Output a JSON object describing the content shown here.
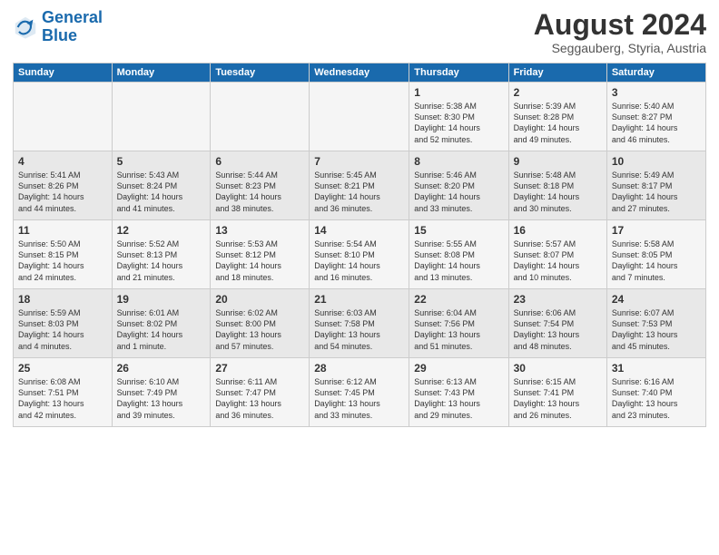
{
  "header": {
    "logo_line1": "General",
    "logo_line2": "Blue",
    "month_title": "August 2024",
    "location": "Seggauberg, Styria, Austria"
  },
  "days_of_week": [
    "Sunday",
    "Monday",
    "Tuesday",
    "Wednesday",
    "Thursday",
    "Friday",
    "Saturday"
  ],
  "weeks": [
    [
      {
        "num": "",
        "info": ""
      },
      {
        "num": "",
        "info": ""
      },
      {
        "num": "",
        "info": ""
      },
      {
        "num": "",
        "info": ""
      },
      {
        "num": "1",
        "info": "Sunrise: 5:38 AM\nSunset: 8:30 PM\nDaylight: 14 hours\nand 52 minutes."
      },
      {
        "num": "2",
        "info": "Sunrise: 5:39 AM\nSunset: 8:28 PM\nDaylight: 14 hours\nand 49 minutes."
      },
      {
        "num": "3",
        "info": "Sunrise: 5:40 AM\nSunset: 8:27 PM\nDaylight: 14 hours\nand 46 minutes."
      }
    ],
    [
      {
        "num": "4",
        "info": "Sunrise: 5:41 AM\nSunset: 8:26 PM\nDaylight: 14 hours\nand 44 minutes."
      },
      {
        "num": "5",
        "info": "Sunrise: 5:43 AM\nSunset: 8:24 PM\nDaylight: 14 hours\nand 41 minutes."
      },
      {
        "num": "6",
        "info": "Sunrise: 5:44 AM\nSunset: 8:23 PM\nDaylight: 14 hours\nand 38 minutes."
      },
      {
        "num": "7",
        "info": "Sunrise: 5:45 AM\nSunset: 8:21 PM\nDaylight: 14 hours\nand 36 minutes."
      },
      {
        "num": "8",
        "info": "Sunrise: 5:46 AM\nSunset: 8:20 PM\nDaylight: 14 hours\nand 33 minutes."
      },
      {
        "num": "9",
        "info": "Sunrise: 5:48 AM\nSunset: 8:18 PM\nDaylight: 14 hours\nand 30 minutes."
      },
      {
        "num": "10",
        "info": "Sunrise: 5:49 AM\nSunset: 8:17 PM\nDaylight: 14 hours\nand 27 minutes."
      }
    ],
    [
      {
        "num": "11",
        "info": "Sunrise: 5:50 AM\nSunset: 8:15 PM\nDaylight: 14 hours\nand 24 minutes."
      },
      {
        "num": "12",
        "info": "Sunrise: 5:52 AM\nSunset: 8:13 PM\nDaylight: 14 hours\nand 21 minutes."
      },
      {
        "num": "13",
        "info": "Sunrise: 5:53 AM\nSunset: 8:12 PM\nDaylight: 14 hours\nand 18 minutes."
      },
      {
        "num": "14",
        "info": "Sunrise: 5:54 AM\nSunset: 8:10 PM\nDaylight: 14 hours\nand 16 minutes."
      },
      {
        "num": "15",
        "info": "Sunrise: 5:55 AM\nSunset: 8:08 PM\nDaylight: 14 hours\nand 13 minutes."
      },
      {
        "num": "16",
        "info": "Sunrise: 5:57 AM\nSunset: 8:07 PM\nDaylight: 14 hours\nand 10 minutes."
      },
      {
        "num": "17",
        "info": "Sunrise: 5:58 AM\nSunset: 8:05 PM\nDaylight: 14 hours\nand 7 minutes."
      }
    ],
    [
      {
        "num": "18",
        "info": "Sunrise: 5:59 AM\nSunset: 8:03 PM\nDaylight: 14 hours\nand 4 minutes."
      },
      {
        "num": "19",
        "info": "Sunrise: 6:01 AM\nSunset: 8:02 PM\nDaylight: 14 hours\nand 1 minute."
      },
      {
        "num": "20",
        "info": "Sunrise: 6:02 AM\nSunset: 8:00 PM\nDaylight: 13 hours\nand 57 minutes."
      },
      {
        "num": "21",
        "info": "Sunrise: 6:03 AM\nSunset: 7:58 PM\nDaylight: 13 hours\nand 54 minutes."
      },
      {
        "num": "22",
        "info": "Sunrise: 6:04 AM\nSunset: 7:56 PM\nDaylight: 13 hours\nand 51 minutes."
      },
      {
        "num": "23",
        "info": "Sunrise: 6:06 AM\nSunset: 7:54 PM\nDaylight: 13 hours\nand 48 minutes."
      },
      {
        "num": "24",
        "info": "Sunrise: 6:07 AM\nSunset: 7:53 PM\nDaylight: 13 hours\nand 45 minutes."
      }
    ],
    [
      {
        "num": "25",
        "info": "Sunrise: 6:08 AM\nSunset: 7:51 PM\nDaylight: 13 hours\nand 42 minutes."
      },
      {
        "num": "26",
        "info": "Sunrise: 6:10 AM\nSunset: 7:49 PM\nDaylight: 13 hours\nand 39 minutes."
      },
      {
        "num": "27",
        "info": "Sunrise: 6:11 AM\nSunset: 7:47 PM\nDaylight: 13 hours\nand 36 minutes."
      },
      {
        "num": "28",
        "info": "Sunrise: 6:12 AM\nSunset: 7:45 PM\nDaylight: 13 hours\nand 33 minutes."
      },
      {
        "num": "29",
        "info": "Sunrise: 6:13 AM\nSunset: 7:43 PM\nDaylight: 13 hours\nand 29 minutes."
      },
      {
        "num": "30",
        "info": "Sunrise: 6:15 AM\nSunset: 7:41 PM\nDaylight: 13 hours\nand 26 minutes."
      },
      {
        "num": "31",
        "info": "Sunrise: 6:16 AM\nSunset: 7:40 PM\nDaylight: 13 hours\nand 23 minutes."
      }
    ]
  ]
}
